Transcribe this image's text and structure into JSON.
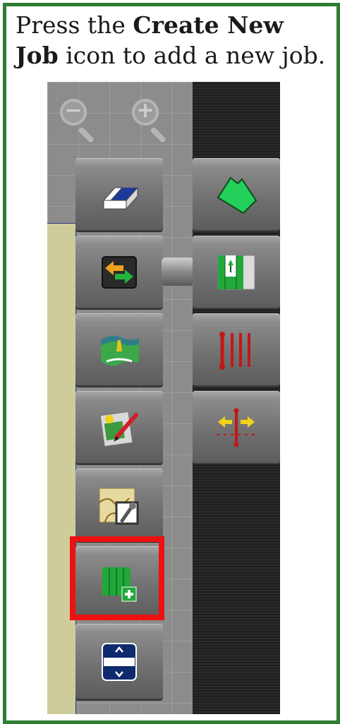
{
  "instruction": {
    "before": "Press the ",
    "bold": "Create New Job",
    "after": " icon to add a new job."
  },
  "zoom_controls": [
    {
      "name": "zoom-out",
      "glyph": "−"
    },
    {
      "name": "zoom-in",
      "glyph": "+"
    }
  ],
  "left_menu": [
    "eraser-icon",
    "swap-icon",
    "boundary-icon",
    "edit-job-icon",
    "job-settings-icon",
    "create-new-job-icon",
    "menu-collapse-icon"
  ],
  "right_menu": [
    "field-boundary-icon",
    "headland-icon",
    "guidance-lines-icon",
    "shift-line-icon"
  ],
  "colors": {
    "frame": "#2f7d32",
    "highlight": "#ee1111",
    "green": "#22a83a",
    "blue": "#0f2a6e",
    "red": "#c01818",
    "yellow": "#f2d21b"
  }
}
